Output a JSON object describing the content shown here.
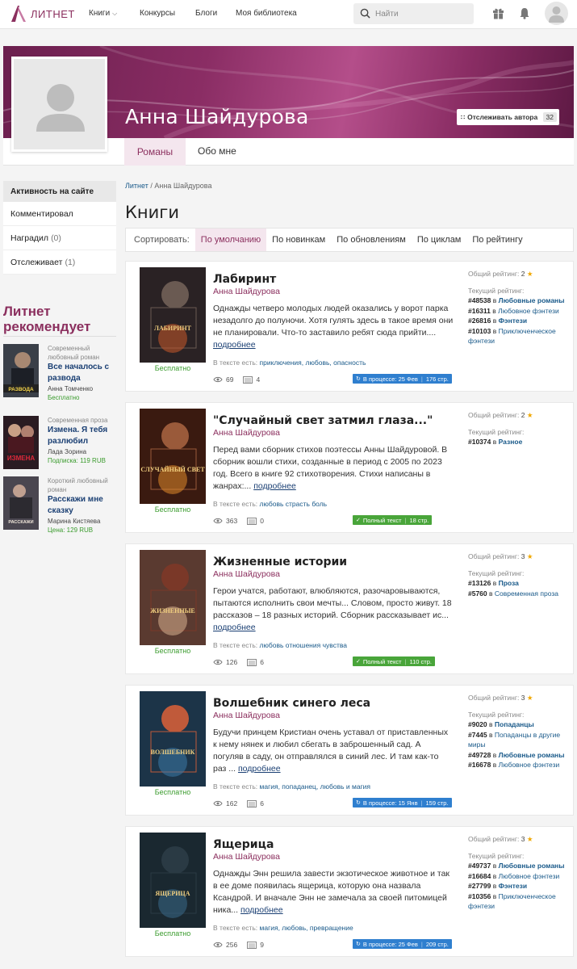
{
  "header": {
    "logo_text": "ЛИТНЕТ",
    "nav": [
      {
        "label": "Книги"
      },
      {
        "label": "Конкурсы"
      },
      {
        "label": "Блоги"
      },
      {
        "label": "Моя библиотека"
      }
    ],
    "search_placeholder": "Найти"
  },
  "profile": {
    "name": "Анна Шайдурова",
    "follow_label": "Отслеживать автора",
    "follow_count": "32",
    "tabs": [
      {
        "label": "Романы"
      },
      {
        "label": "Обо мне"
      }
    ]
  },
  "sidebar": {
    "head": "Активность на сайте",
    "items": [
      {
        "label": "Комментировал",
        "count": ""
      },
      {
        "label": "Наградил",
        "count": "(0)"
      },
      {
        "label": "Отслеживает",
        "count": "(1)"
      }
    ],
    "rec_title": "Литнет рекомендует",
    "recs": [
      {
        "genre": "Современный любовный роман",
        "name": "Все началось с развода",
        "author": "Анна Томченко",
        "price": "Бесплатно",
        "cover_text": "РАЗВОДА"
      },
      {
        "genre": "Современная проза",
        "name": "Измена. Я тебя разлюбил",
        "author": "Лада Зорина",
        "price": "Подписка: 119 RUB",
        "cover_text": "ИЗМЕНА"
      },
      {
        "genre": "Короткий любовный роман",
        "name": "Расскажи мне сказку",
        "author": "Марина Кистяева",
        "price": "Цена: 129 RUB",
        "cover_text": "РАССКАЖИ"
      }
    ]
  },
  "main": {
    "breadcrumb": [
      "Литнет",
      "Анна Шайдурова"
    ],
    "heading": "Книги",
    "sort_label": "Сортировать:",
    "sort_options": [
      "По умолчанию",
      "По новинкам",
      "По обновлениям",
      "По циклам",
      "По рейтингу"
    ],
    "rating_general_label": "Общий рейтинг:",
    "rating_current_label": "Текущий рейтинг:",
    "in_text_label": "В тексте есть:",
    "more_label": "подробнее",
    "free_label": "Бесплатно",
    "books": [
      {
        "title": "Лабиринт",
        "author": "Анна Шайдурова",
        "desc": "Однажды четверо молодых людей оказались у ворот парка незадолго до полуночи. Хотя гулять здесь в такое время они не планировали. Что-то заставило ребят сюда прийти....",
        "tags": "приключения, любовь, опасность",
        "views": "69",
        "libs": "4",
        "status": "В процессе: 25 Фев",
        "pages": "176 стр.",
        "status_type": "blue",
        "rating": "2",
        "cover_text": "ЛАБИРИНТ",
        "positions": [
          {
            "pos": "#48538",
            "genre": "Любовные романы",
            "bold": true
          },
          {
            "pos": "#16311",
            "genre": "Любовное фэнтези",
            "bold": false
          },
          {
            "pos": "#26816",
            "genre": "Фэнтези",
            "bold": true
          },
          {
            "pos": "#10103",
            "genre": "Приключенческое фэнтези",
            "bold": false
          }
        ]
      },
      {
        "title": "\"Случайный свет затмил глаза...\"",
        "author": "Анна Шайдурова",
        "desc": "Перед вами сборник стихов поэтессы Анны Шайдуровой. В сборник вошли стихи, созданные в период с 2005 по 2023 год. Всего в книге 92 стихотворения. Стихи написаны в жанрах:...",
        "tags": "любовь страсть боль",
        "views": "363",
        "libs": "0",
        "status": "Полный текст",
        "pages": "18 стр.",
        "status_type": "green",
        "rating": "2",
        "cover_text": "СЛУЧАЙНЫЙ СВЕТ",
        "positions": [
          {
            "pos": "#10374",
            "genre": "Разное",
            "bold": true
          }
        ]
      },
      {
        "title": "Жизненные истории",
        "author": "Анна Шайдурова",
        "desc": "Герои учатся, работают, влюбляются, разочаровываются, пытаются исполнить свои мечты... Словом, просто живут. 18 рассказов – 18 разных историй. Сборник рассказывает ис...",
        "tags": "любовь отношения чувства",
        "views": "126",
        "libs": "6",
        "status": "Полный текст",
        "pages": "110 стр.",
        "status_type": "green",
        "rating": "3",
        "cover_text": "ЖИЗНЕННЫЕ",
        "positions": [
          {
            "pos": "#13126",
            "genre": "Проза",
            "bold": true
          },
          {
            "pos": "#5760",
            "genre": "Современная проза",
            "bold": false
          }
        ]
      },
      {
        "title": "Волшебник синего леса",
        "author": "Анна Шайдурова",
        "desc": "Будучи принцем Кристиан очень уставал от приставленных к нему нянек и любил сбегать в заброшенный сад. А погуляв в саду, он отправлялся в синий лес. И там как-то раз ...",
        "tags": "магия, попаданец, любовь и магия",
        "views": "162",
        "libs": "6",
        "status": "В процессе: 15 Янв",
        "pages": "159 стр.",
        "status_type": "blue",
        "rating": "3",
        "cover_text": "ВОЛШЕБНИК",
        "positions": [
          {
            "pos": "#9020",
            "genre": "Попаданцы",
            "bold": true
          },
          {
            "pos": "#7445",
            "genre": "Попаданцы в другие миры",
            "bold": false
          },
          {
            "pos": "#49728",
            "genre": "Любовные романы",
            "bold": true
          },
          {
            "pos": "#16678",
            "genre": "Любовное фэнтези",
            "bold": false
          }
        ]
      },
      {
        "title": "Ящерица",
        "author": "Анна Шайдурова",
        "desc": "Однажды Энн решила завести экзотическое животное и так в ее доме появилась ящерица, которую она назвала Ксандрой. И вначале Энн не замечала за своей питомицей ника...",
        "tags": "магия, любовь, превращение",
        "views": "256",
        "libs": "9",
        "status": "В процессе: 25 Фев",
        "pages": "209 стр.",
        "status_type": "blue",
        "rating": "3",
        "cover_text": "ЯЩЕРИЦА",
        "positions": [
          {
            "pos": "#49737",
            "genre": "Любовные романы",
            "bold": true
          },
          {
            "pos": "#16684",
            "genre": "Любовное фэнтези",
            "bold": false
          },
          {
            "pos": "#27799",
            "genre": "Фэнтези",
            "bold": true
          },
          {
            "pos": "#10356",
            "genre": "Приключенческое фэнтези",
            "bold": false
          }
        ]
      }
    ]
  },
  "colors": {
    "brand": "#8b2f5e",
    "link": "#1a5a8a",
    "free": "#3a9b2d",
    "status_blue": "#2f7fcf",
    "status_green": "#49a53a"
  }
}
